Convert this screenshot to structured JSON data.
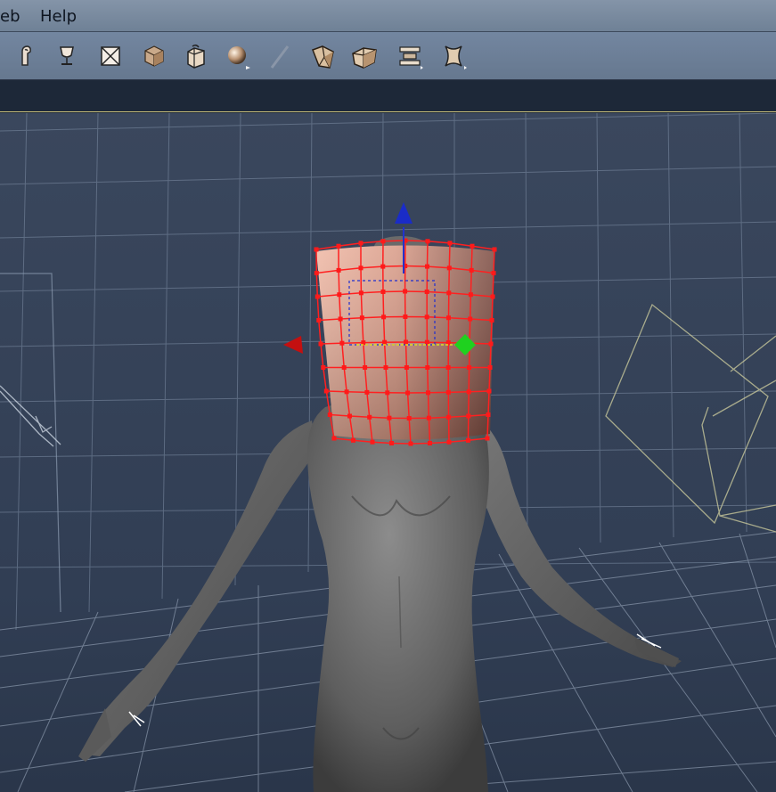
{
  "menu": {
    "items": [
      {
        "label": "eb"
      },
      {
        "label": "Help"
      }
    ]
  },
  "toolbar": {
    "tools": [
      {
        "icon": "joint-editor-icon"
      },
      {
        "icon": "goblet-icon"
      },
      {
        "icon": "box-frame-icon"
      },
      {
        "icon": "cube-icon"
      },
      {
        "icon": "bag-icon"
      },
      {
        "icon": "sphere-icon"
      },
      {
        "icon": "pen-icon"
      },
      {
        "icon": "twist-icon"
      },
      {
        "icon": "taper-icon"
      },
      {
        "icon": "scale-icon"
      },
      {
        "icon": "warp-icon"
      }
    ]
  },
  "colors": {
    "viewport_bg": "#344258",
    "grid": "#8c9bb0",
    "mesh_handles": "#ff1a1a",
    "figure": "#6a6a6a",
    "axis_x": "#cc1111",
    "axis_y": "#22cc22",
    "axis_z": "#1133cc"
  }
}
